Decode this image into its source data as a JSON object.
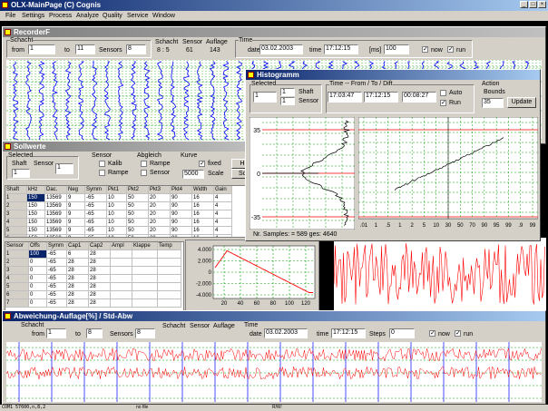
{
  "main": {
    "title": "OLX-MainPage (C) Cognis"
  },
  "menu": [
    "File",
    "Settings",
    "Process",
    "Analyze",
    "Quality",
    "Service",
    "Window"
  ],
  "recorder": {
    "title": "RecorderF",
    "schacht_label": "Schacht",
    "from_label": "from",
    "from_value": "1",
    "to_label": "to",
    "to_value": "11",
    "sensors_label": "Sensors",
    "sensors_value": "8",
    "info_headers": [
      "Schacht",
      "Sensor",
      "Auflage"
    ],
    "info_values": [
      "8 : 5",
      "61",
      "143"
    ],
    "time_label": "Time",
    "date_label": "date",
    "date_value": "03.02.2003",
    "time_field_label": "time",
    "time_value": "17:12:15",
    "ms_label": "[ms]",
    "ms_value": "100",
    "now_label": "now",
    "run_label": "run"
  },
  "sollwerte": {
    "title": "Sollwerte",
    "selected_label": "Selected",
    "shaft_label": "Shaft",
    "sensor_label": "Sensor",
    "shaft_value": "1",
    "sensor_value": "1",
    "sensor_group_label": "Sensor",
    "kalib_label": "Kalib",
    "rampe_label": "Rampe",
    "abgleich_label": "Abgleich",
    "abgleich_rampe": "Rampe",
    "abgleich_sensor": "Sensor",
    "kurve_label": "Kurve",
    "fixed_label": "fixed",
    "kurve_value": "5000",
    "scale_label": "Scale",
    "hu_button": "Hu",
    "sco_button": "Sco",
    "table1": {
      "headers": [
        "Shaft",
        "kHz",
        "Dac.",
        "Neg",
        "Symm",
        "Pkt1",
        "Pkt2",
        "Pkt3",
        "Pkt4",
        "Width",
        "Gain"
      ],
      "rows": [
        [
          "1",
          "150",
          "13569",
          "9",
          "-65",
          "10",
          "50",
          "20",
          "90",
          "16",
          "4"
        ],
        [
          "2",
          "150",
          "13569",
          "9",
          "-65",
          "10",
          "50",
          "20",
          "90",
          "16",
          "4"
        ],
        [
          "3",
          "150",
          "13569",
          "9",
          "-65",
          "10",
          "50",
          "20",
          "90",
          "16",
          "4"
        ],
        [
          "4",
          "150",
          "13569",
          "9",
          "-65",
          "10",
          "50",
          "20",
          "90",
          "16",
          "4"
        ],
        [
          "5",
          "150",
          "13569",
          "9",
          "-65",
          "10",
          "50",
          "20",
          "90",
          "16",
          "4"
        ],
        [
          "6",
          "150",
          "13569",
          "9",
          "-65",
          "10",
          "50",
          "20",
          "90",
          "16",
          "4"
        ]
      ]
    },
    "table2": {
      "headers": [
        "Sensor",
        "Offs",
        "Symm",
        "Cap1",
        "Cap2",
        "Ampl",
        "Klappe",
        "Temp"
      ],
      "rows": [
        [
          "1",
          "100",
          "-65",
          "6",
          "28",
          "",
          "",
          ""
        ],
        [
          "2",
          "0",
          "-65",
          "28",
          "28",
          "",
          "",
          ""
        ],
        [
          "3",
          "0",
          "-65",
          "28",
          "28",
          "",
          "",
          ""
        ],
        [
          "4",
          "0",
          "-65",
          "28",
          "28",
          "",
          "",
          ""
        ],
        [
          "5",
          "0",
          "-65",
          "28",
          "28",
          "",
          "",
          ""
        ],
        [
          "6",
          "0",
          "-65",
          "28",
          "28",
          "",
          "",
          ""
        ],
        [
          "7",
          "0",
          "-65",
          "28",
          "28",
          "",
          "",
          ""
        ]
      ]
    }
  },
  "curve_chart": {
    "y_ticks": [
      "4.000",
      "2.000",
      "0",
      "-2.000",
      "-4.000"
    ],
    "x_ticks": [
      "20",
      "40",
      "60",
      "80",
      "100",
      "120"
    ]
  },
  "histogramm": {
    "title": "Histogramm",
    "selected_label": "Selected",
    "shaft_label": "Shaft",
    "sensor_label": "Sensor",
    "selected_value": "1",
    "shaft_value": "1",
    "sensor_value": "1",
    "time_label": "Time -- From / To / Dift",
    "from_value": "17:03:47",
    "to_value": "17:12:15",
    "dift_value": "00:08:27",
    "auto_label": "Auto",
    "run_label": "Run",
    "action_label": "Action",
    "bounds_label": "Bounds",
    "bounds_value": "35",
    "update_button": "Update",
    "y_ticks": [
      "35",
      "0",
      "-35"
    ],
    "prob_ticks": [
      ".01",
      "1",
      ".5",
      "1",
      "2",
      "5",
      "10",
      "30",
      "50",
      "70",
      "90",
      "95",
      "99",
      ".9",
      "99"
    ],
    "samples_text": "Nr. Samples: = 589 ges: 4640"
  },
  "abweichung": {
    "title": "Abweichung-Auflage[%] / Std-Abw",
    "schacht_label": "Schacht",
    "from_label": "from",
    "from_value": "1",
    "to_label": "to",
    "to_value": "8",
    "sensors_label": "Sensors",
    "sensors_value": "8",
    "info_headers": [
      "Schacht",
      "Sensor",
      "Auflage"
    ],
    "time_label": "Time",
    "date_label": "date",
    "date_value": "03.02.2003",
    "time_field_label": "time",
    "time_value": "17:12:15",
    "steps_label": "Steps",
    "steps_value": "0",
    "now_label": "now",
    "run_label": "run"
  },
  "status_bar": {
    "left": "COM1 57600,n,8,2",
    "mid": "no file",
    "right": "R/W:"
  },
  "colors": {
    "recorder_trace": "#0000ff",
    "red_trace": "#ff0000",
    "grid": "#00a000"
  }
}
